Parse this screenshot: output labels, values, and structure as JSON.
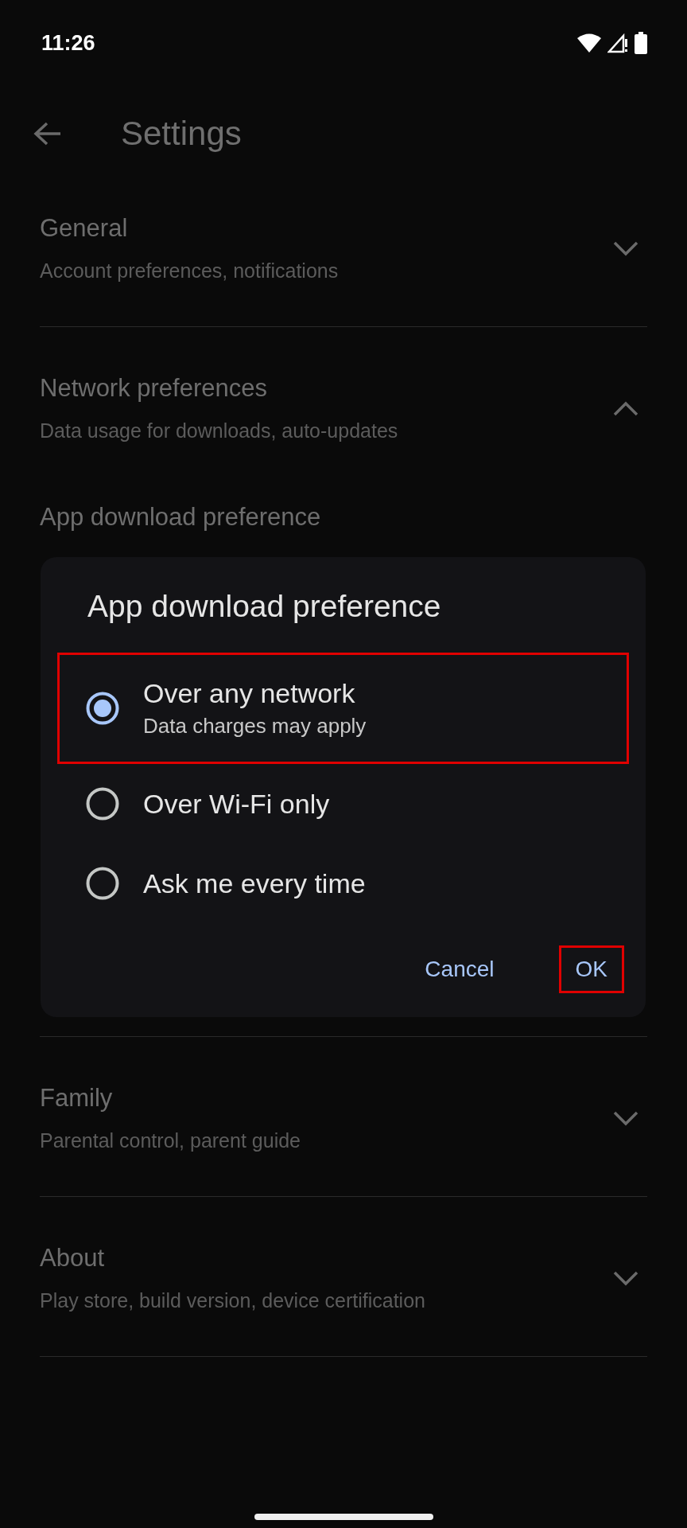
{
  "status_bar": {
    "time": "11:26"
  },
  "header": {
    "title": "Settings"
  },
  "sections": [
    {
      "title": "General",
      "subtitle": "Account preferences, notifications",
      "expanded": false
    },
    {
      "title": "Network preferences",
      "subtitle": "Data usage for downloads, auto-updates",
      "expanded": true,
      "items": [
        {
          "title": "App download preference"
        }
      ]
    },
    {
      "title": "Family",
      "subtitle": "Parental control, parent guide",
      "expanded": false
    },
    {
      "title": "About",
      "subtitle": "Play store, build version, device certification",
      "expanded": false
    }
  ],
  "dialog": {
    "title": "App download preference",
    "options": [
      {
        "label": "Over any network",
        "description": "Data charges may apply",
        "selected": true,
        "highlighted": true
      },
      {
        "label": "Over Wi-Fi only",
        "selected": false,
        "highlighted": false
      },
      {
        "label": "Ask me every time",
        "selected": false,
        "highlighted": false
      }
    ],
    "buttons": [
      {
        "label": "Cancel",
        "highlighted": false
      },
      {
        "label": "OK",
        "highlighted": true
      }
    ]
  }
}
